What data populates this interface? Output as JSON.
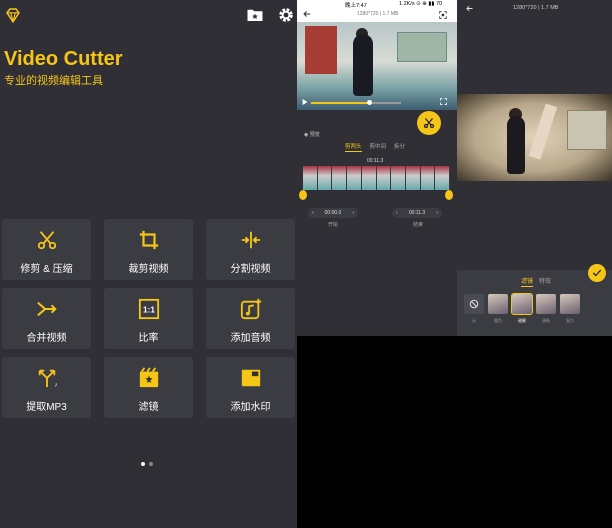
{
  "home": {
    "title": "Video Cutter",
    "subtitle": "专业的视频编辑工具",
    "tools": [
      {
        "label": "修剪 & 压缩",
        "icon": "scissors-icon"
      },
      {
        "label": "裁剪视频",
        "icon": "crop-icon"
      },
      {
        "label": "分割视频",
        "icon": "split-icon"
      },
      {
        "label": "合并视频",
        "icon": "merge-icon"
      },
      {
        "label": "比率",
        "icon": "ratio-icon"
      },
      {
        "label": "添加音频",
        "icon": "music-add-icon"
      },
      {
        "label": "提取MP3",
        "icon": "extract-icon"
      },
      {
        "label": "滤镜",
        "icon": "filter-icon"
      },
      {
        "label": "添加水印",
        "icon": "watermark-icon"
      }
    ],
    "ratio_glyph": "1:1",
    "page_indicator": {
      "count": 2,
      "active": 0
    }
  },
  "trim_screen": {
    "status_time": "晚上7:47",
    "status_net": "1.2K/s ⊙ ⊕ ▮▮ 70",
    "resolution": "1280*720 | 1.7 MB",
    "preview_label": "预览",
    "tabs": [
      "剪两头",
      "剪中间",
      "拆分"
    ],
    "active_tab": 0,
    "timecode": "00:11.3",
    "start_time": "00:00.0",
    "end_time": "00:11.3",
    "start_label": "开始",
    "end_label": "结束"
  },
  "filter_screen": {
    "resolution": "1280*720 | 1.7 MB",
    "tabs": [
      "滤镜",
      "特效"
    ],
    "active_tab": 0,
    "filters": [
      "无",
      "暖色",
      "甜蜜",
      "清新",
      "复古"
    ],
    "selected_filter": 2
  },
  "colors": {
    "accent": "#f5c518",
    "background": "#2f2f35",
    "tile": "#3b3b42"
  }
}
